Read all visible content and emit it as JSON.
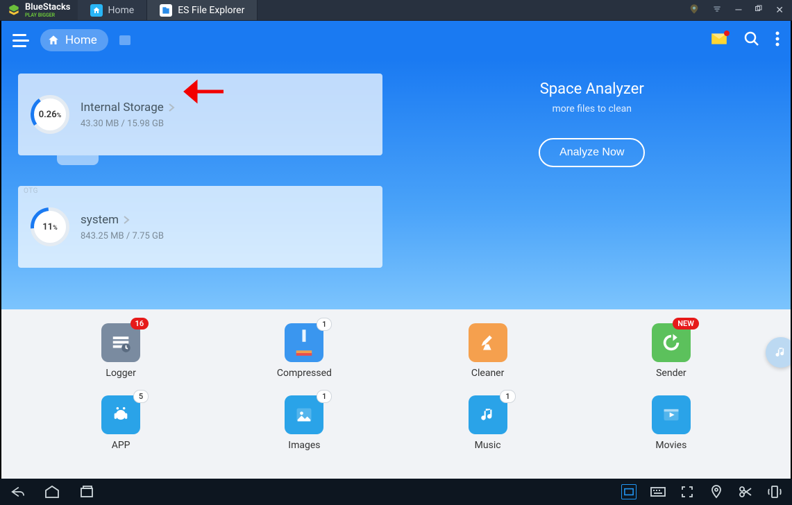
{
  "bluestacks": {
    "brand": "BlueStacks",
    "tagline": "Play Bigger",
    "tabs": [
      {
        "label": "Home",
        "active": false
      },
      {
        "label": "ES File Explorer",
        "active": true
      }
    ]
  },
  "es_header": {
    "home_label": "Home"
  },
  "storage": {
    "items": [
      {
        "percent": "0.26",
        "unit": "%",
        "title": "Internal Storage",
        "sub": "43.30 MB / 15.98 GB",
        "tag": ""
      },
      {
        "percent": "11",
        "unit": "%",
        "title": "system",
        "sub": "843.25 MB / 7.75 GB",
        "tag": "OTG"
      }
    ]
  },
  "analyzer": {
    "title": "Space Analyzer",
    "sub": "more files to clean",
    "button": "Analyze Now"
  },
  "categories": {
    "row1": [
      {
        "label": "Logger",
        "badge": "16",
        "badgeStyle": "red",
        "color": "#7a8ba0"
      },
      {
        "label": "Compressed",
        "badge": "1",
        "badgeStyle": "white",
        "color": "#3a96ef"
      },
      {
        "label": "Cleaner",
        "badge": "",
        "badgeStyle": "",
        "color": "#f5a04e"
      },
      {
        "label": "Sender",
        "badge": "NEW",
        "badgeStyle": "red",
        "color": "#5cc15c"
      }
    ],
    "row2": [
      {
        "label": "APP",
        "badge": "5",
        "badgeStyle": "white",
        "color": "#2aa3e8"
      },
      {
        "label": "Images",
        "badge": "1",
        "badgeStyle": "white",
        "color": "#2aa3e8"
      },
      {
        "label": "Music",
        "badge": "1",
        "badgeStyle": "white",
        "color": "#2aa3e8"
      },
      {
        "label": "Movies",
        "badge": "",
        "badgeStyle": "",
        "color": "#2aa3e8"
      }
    ]
  }
}
